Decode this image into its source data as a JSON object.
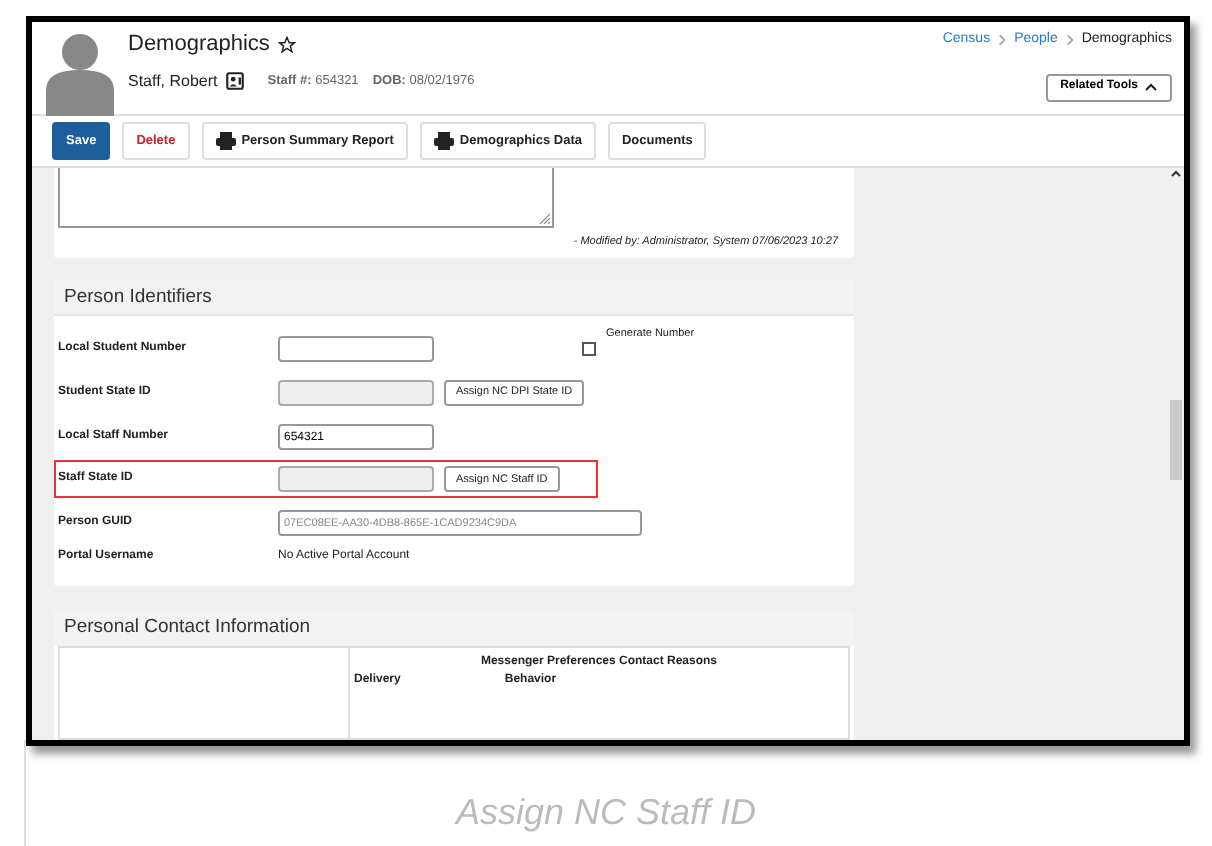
{
  "header": {
    "title": "Demographics",
    "person_name": "Staff, Robert",
    "staff_label": "Staff #:",
    "staff_number": "654321",
    "dob_label": "DOB:",
    "dob": "08/02/1976",
    "breadcrumb": [
      "Census",
      "People",
      "Demographics"
    ],
    "related_tools": "Related Tools"
  },
  "toolbar": [
    {
      "label": "Save",
      "kind": "primary"
    },
    {
      "label": "Delete",
      "kind": "danger"
    },
    {
      "label": "Person Summary Report",
      "kind": "print"
    },
    {
      "label": "Demographics Data",
      "kind": "print"
    },
    {
      "label": "Documents",
      "kind": "plain"
    }
  ],
  "comments": {
    "modified": "- Modified by: Administrator, System 07/06/2023 10:27"
  },
  "person_identifiers": {
    "title": "Person Identifiers",
    "rows": [
      {
        "label": "Local Student Number",
        "kind": "input",
        "value": "",
        "checkbox_label": "Generate Number",
        "checked": false
      },
      {
        "label": "Student State ID",
        "kind": "disabled",
        "value": "",
        "button": "Assign NC DPI State ID"
      },
      {
        "label": "Local Staff Number",
        "kind": "input",
        "value": "654321"
      },
      {
        "label": "Staff State ID",
        "kind": "disabled",
        "value": "",
        "button": "Assign NC Staff ID",
        "highlighted": true
      },
      {
        "label": "Person GUID",
        "kind": "guid",
        "value": "07EC08EE-AA30-4DB8-865E-1CAD9234C9DA"
      },
      {
        "label": "Portal Username",
        "kind": "text",
        "value": "No Active Portal Account"
      }
    ]
  },
  "personal_contact": {
    "title": "Personal Contact Information",
    "table_title": "Messenger Preferences Contact Reasons",
    "columns": [
      "Delivery",
      "Behavior"
    ]
  },
  "caption": "Assign NC Staff ID"
}
